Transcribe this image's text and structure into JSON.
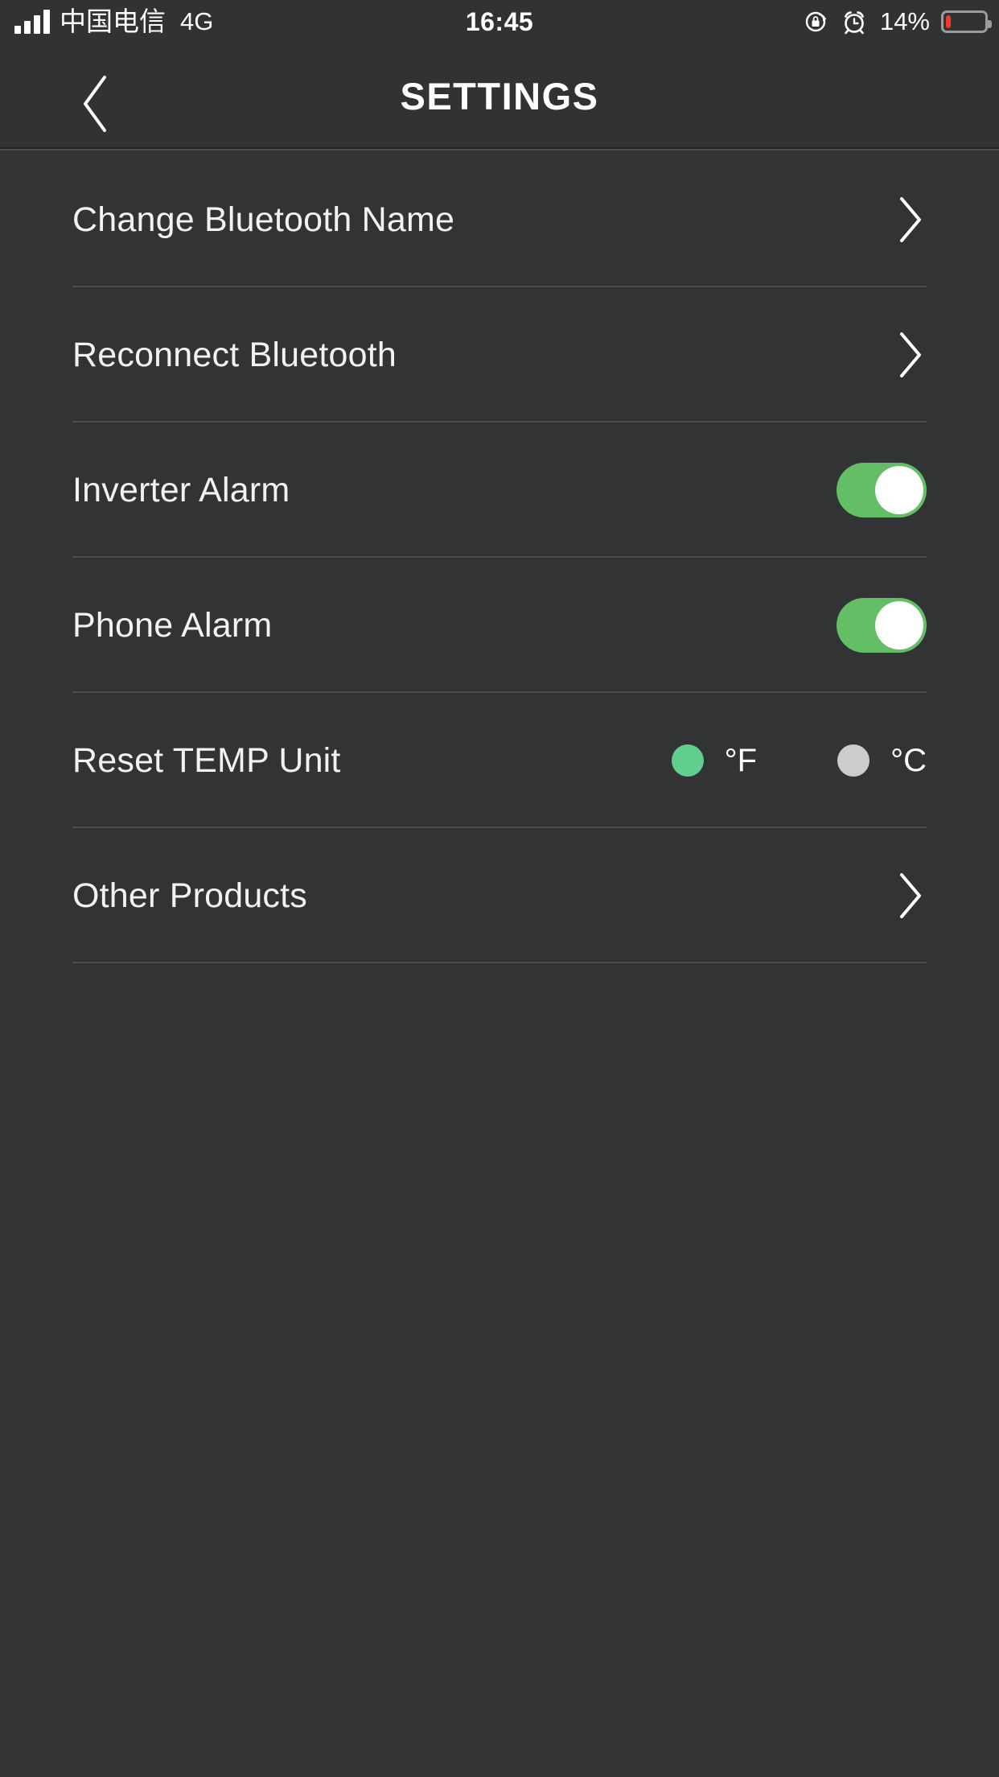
{
  "status_bar": {
    "carrier": "中国电信",
    "network": "4G",
    "time": "16:45",
    "battery_percent": "14%",
    "battery_level": 14,
    "battery_color": "#f2392c",
    "signal_bars": 4,
    "icons": [
      "rotation-lock-icon",
      "alarm-clock-icon"
    ]
  },
  "header": {
    "back_icon": "chevron-left-icon",
    "title": "SETTINGS"
  },
  "colors": {
    "background": "#323334",
    "row_text": "#f2f2f2",
    "separator": "#4b4d4f",
    "toggle_on": "#63be65",
    "radio_selected": "#62ce8e",
    "radio_unselected": "#cccccc"
  },
  "settings_rows": [
    {
      "label": "Change Bluetooth Name",
      "control": "chevron"
    },
    {
      "label": "Reconnect Bluetooth",
      "control": "chevron"
    },
    {
      "label": "Inverter Alarm",
      "control": "toggle",
      "state": "on"
    },
    {
      "label": "Phone Alarm",
      "control": "toggle",
      "state": "on"
    },
    {
      "label": "Reset TEMP Unit",
      "control": "radio"
    },
    {
      "label": "Other Products",
      "control": "chevron"
    }
  ],
  "temp_unit_options": [
    {
      "label": "°F",
      "selected": true
    },
    {
      "label": "°C",
      "selected": false
    }
  ]
}
